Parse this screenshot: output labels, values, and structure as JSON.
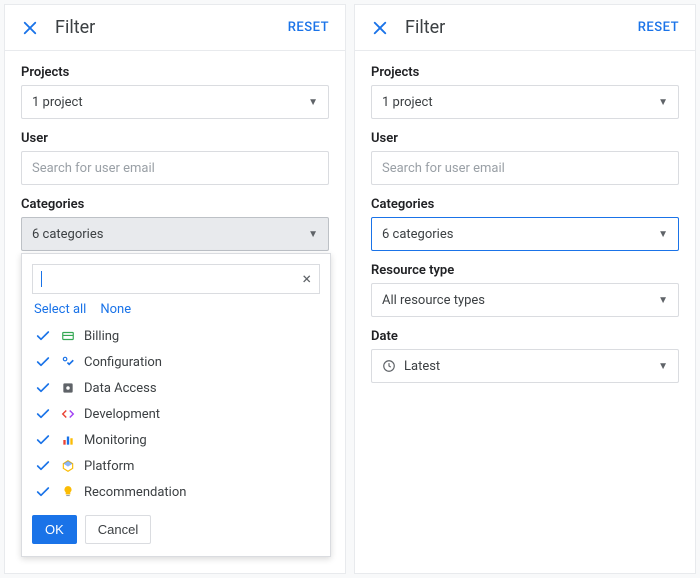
{
  "left": {
    "title": "Filter",
    "reset": "RESET",
    "projects": {
      "label": "Projects",
      "value": "1 project"
    },
    "user": {
      "label": "User",
      "placeholder": "Search for user email"
    },
    "categories": {
      "label": "Categories",
      "value": "6 categories",
      "select_all": "Select all",
      "none": "None",
      "ok": "OK",
      "cancel": "Cancel",
      "items": [
        {
          "name": "Billing",
          "checked": true,
          "icon": "billing"
        },
        {
          "name": "Configuration",
          "checked": true,
          "icon": "config"
        },
        {
          "name": "Data Access",
          "checked": false,
          "icon": "data"
        },
        {
          "name": "Development",
          "checked": true,
          "icon": "dev"
        },
        {
          "name": "Monitoring",
          "checked": true,
          "icon": "monitor"
        },
        {
          "name": "Platform",
          "checked": true,
          "icon": "platform"
        },
        {
          "name": "Recommendation",
          "checked": true,
          "icon": "recommend"
        }
      ]
    }
  },
  "right": {
    "title": "Filter",
    "reset": "RESET",
    "projects": {
      "label": "Projects",
      "value": "1 project"
    },
    "user": {
      "label": "User",
      "placeholder": "Search for user email"
    },
    "categories": {
      "label": "Categories",
      "value": "6 categories"
    },
    "resource": {
      "label": "Resource type",
      "value": "All resource types"
    },
    "date": {
      "label": "Date",
      "value": "Latest"
    }
  }
}
